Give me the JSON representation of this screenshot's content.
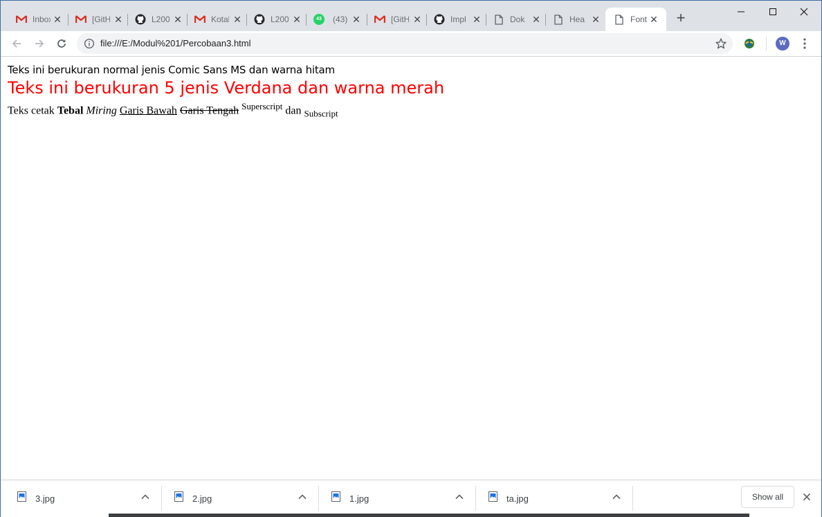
{
  "browser": {
    "tabs": [
      {
        "favicon": "gmail-icon",
        "title": "Inbox"
      },
      {
        "favicon": "gmail-icon",
        "title": "[GitHub]"
      },
      {
        "favicon": "github-icon",
        "title": "L200"
      },
      {
        "favicon": "gmail-icon",
        "title": "Kotak"
      },
      {
        "favicon": "github-icon",
        "title": "L200"
      },
      {
        "favicon": "whatsapp-icon",
        "title": "(43)",
        "badge": "43"
      },
      {
        "favicon": "gmail-icon",
        "title": "[GitHub]"
      },
      {
        "favicon": "github-icon",
        "title": "Impl"
      },
      {
        "favicon": "document-icon",
        "title": "Dok"
      },
      {
        "favicon": "document-icon",
        "title": "Hea"
      },
      {
        "favicon": "document-icon",
        "title": "Font",
        "active": true
      }
    ],
    "new_tab_label": "+",
    "address": "file:///E:/Modul%201/Percobaan3.html",
    "profile_initial": "W",
    "colors": {
      "gmail_red": "#d93025",
      "whatsapp_green": "#25d366",
      "avatar": "#5c6bc0"
    }
  },
  "page": {
    "line1": "Teks ini berukuran normal jenis Comic Sans MS dan warna hitam",
    "line2": "Teks ini berukuran 5 jenis Verdana dan warna merah",
    "line3": {
      "prefix": "Teks cetak",
      "bold": "Tebal",
      "italic": "Miring",
      "underline": "Garis Bawah",
      "strike": "Garis Tengah",
      "superscript": "Superscript",
      "middle": "dan",
      "subscript": "Subscript"
    },
    "colors": {
      "red_text": "#ff0000",
      "normal_text": "#000000"
    }
  },
  "downloads": {
    "items": [
      {
        "name": "3.jpg"
      },
      {
        "name": "2.jpg"
      },
      {
        "name": "1.jpg"
      },
      {
        "name": "ta.jpg"
      }
    ],
    "show_all_label": "Show all"
  }
}
